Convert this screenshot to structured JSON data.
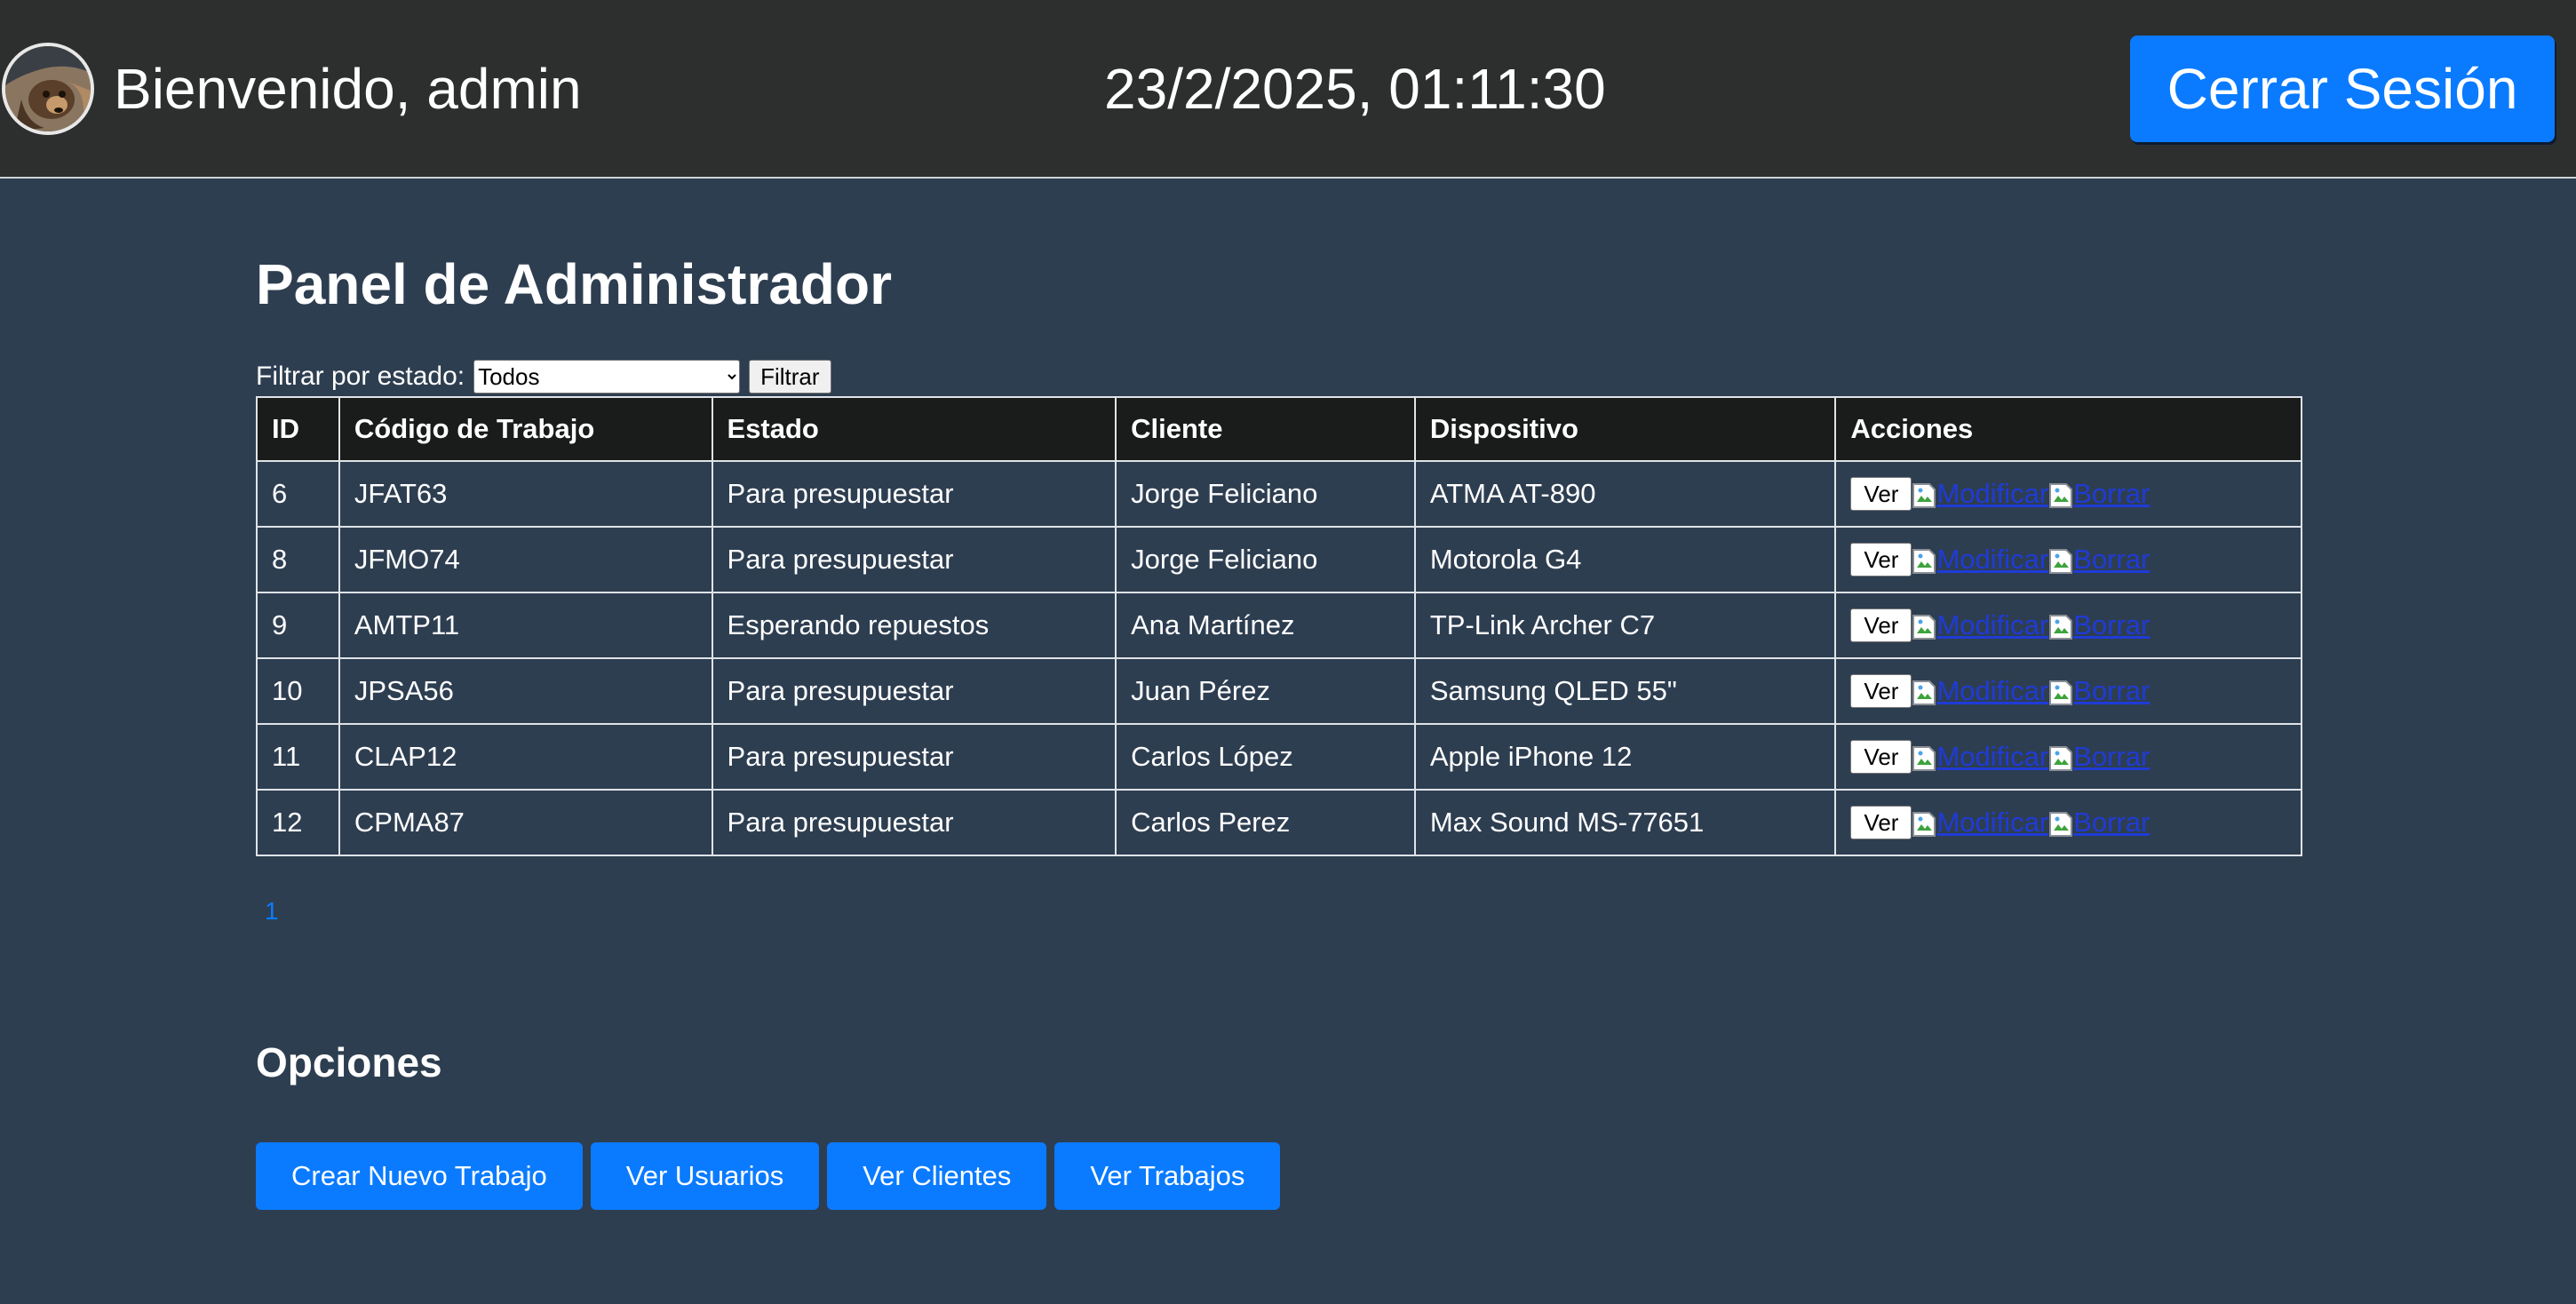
{
  "header": {
    "welcome": "Bienvenido, admin",
    "datetime": "23/2/2025, 01:11:30",
    "logout_label": "Cerrar Sesión"
  },
  "panel": {
    "title": "Panel de Administrador",
    "filter_label": "Filtrar por estado:",
    "filter_selected": "Todos",
    "filter_button": "Filtrar"
  },
  "table": {
    "columns": [
      "ID",
      "Código de Trabajo",
      "Estado",
      "Cliente",
      "Dispositivo",
      "Acciones"
    ],
    "rows": [
      {
        "id": "6",
        "code": "JFAT63",
        "status": "Para presupuestar",
        "client": "Jorge Feliciano",
        "device": "ATMA AT-890"
      },
      {
        "id": "8",
        "code": "JFMO74",
        "status": "Para presupuestar",
        "client": "Jorge Feliciano",
        "device": "Motorola G4"
      },
      {
        "id": "9",
        "code": "AMTP11",
        "status": "Esperando repuestos",
        "client": "Ana Martínez",
        "device": "TP-Link Archer C7"
      },
      {
        "id": "10",
        "code": "JPSA56",
        "status": "Para presupuestar",
        "client": "Juan Pérez",
        "device": "Samsung QLED 55\""
      },
      {
        "id": "11",
        "code": "CLAP12",
        "status": "Para presupuestar",
        "client": "Carlos López",
        "device": "Apple iPhone 12"
      },
      {
        "id": "12",
        "code": "CPMA87",
        "status": "Para presupuestar",
        "client": "Carlos Perez",
        "device": "Max Sound MS-77651"
      }
    ],
    "actions": {
      "view_label": "Ver",
      "modify_label": "Modificar",
      "delete_label": "Borrar"
    }
  },
  "pagination": {
    "current_page": "1"
  },
  "options": {
    "title": "Opciones",
    "buttons": [
      "Crear Nuevo Trabajo",
      "Ver Usuarios",
      "Ver Clientes",
      "Ver Trabajos"
    ]
  },
  "colors": {
    "page_bg": "#2e3e51",
    "topbar_bg": "#2d2f2f",
    "accent": "#0a7bff",
    "table_header_bg": "#1a1c1c",
    "link": "#1f3bd6"
  },
  "icons": {
    "avatar": "user-avatar-photo",
    "broken_image": "broken-image-icon"
  }
}
